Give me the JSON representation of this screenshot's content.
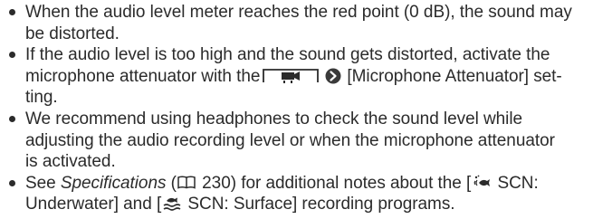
{
  "notes": [
    {
      "line1": "When the audio level meter reaches the red point (0 dB), the sound may",
      "line2": "be distorted."
    },
    {
      "line1": "If the audio level is too high and the sound gets distorted, activate the",
      "line2_before": "microphone attenuator with the",
      "line2_after": "[Microphone Attenuator] set-",
      "line3": "ting."
    },
    {
      "line1": "We recommend using headphones to check the sound level while",
      "line2": "adjusting the audio recording level or when the microphone attenuator",
      "line3": "is activated."
    },
    {
      "line1_before": "See ",
      "line1_italic": "Specifications",
      "line1_paren_open": " (",
      "line1_page": " 230) for additional notes about the [",
      "line1_scn_underwater": " SCN:",
      "line2_start": "Underwater] and [",
      "line2_scn_surface": " SCN: Surface] recording programs."
    }
  ],
  "icons": {
    "menu_tab": "movie-mode-menu-tab-icon",
    "arrow": "arrow-right-button-icon",
    "book": "book-reference-icon",
    "underwater": "underwater-scene-icon",
    "surface": "surface-scene-icon"
  }
}
